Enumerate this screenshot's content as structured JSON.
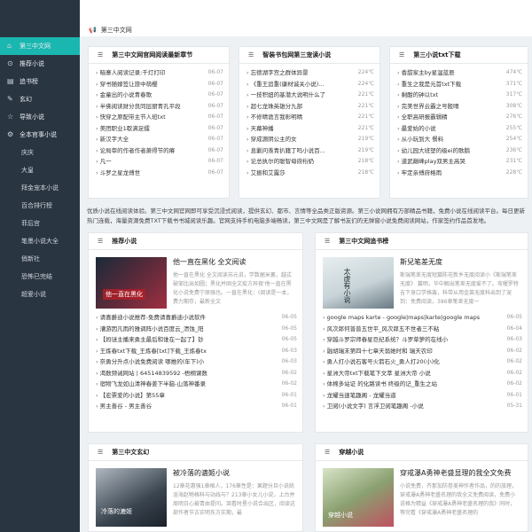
{
  "sidebar": {
    "items": [
      {
        "label": "第三中文网",
        "icon": "home-icon"
      },
      {
        "label": "推荐小说",
        "icon": "circle-icon"
      },
      {
        "label": "追书榜",
        "icon": "list-icon"
      },
      {
        "label": "玄幻",
        "icon": "pencil-icon"
      },
      {
        "label": "导致小说",
        "icon": "star-icon"
      },
      {
        "label": "全本官事小说",
        "icon": "gear-icon"
      }
    ],
    "subitems": [
      "庆庆",
      "大皇",
      "拜金宠本小说",
      "百合排行榜",
      "菲后宫",
      "笔墨小说大全",
      "俏新社",
      "恐怖已完结",
      "超爱小说"
    ]
  },
  "notice": {
    "icon": "bullhorn-icon",
    "text": "第三中文网"
  },
  "box1": {
    "title": "第三中文网官网阅读最新章节",
    "rows": [
      {
        "t": "暗寨人阅读记录:千灯打印",
        "v": "06-07"
      },
      {
        "t": "穿书随嫁签让旅中萌樱",
        "v": "06-07"
      },
      {
        "t": "金童出的小说青春歌",
        "v": "06-07"
      },
      {
        "t": "半佛阅读财分良同层厨青孔平段",
        "v": "06-07"
      },
      {
        "t": "快穿之原配带主节人班txt",
        "v": "06-07"
      },
      {
        "t": "美团职业1歇满足擂",
        "v": "06-07"
      },
      {
        "t": "新汉字大全",
        "v": "06-07"
      },
      {
        "t": "论局审的作者作者萧得节的瘠",
        "v": "06-07"
      },
      {
        "t": "凡一",
        "v": "06-07"
      },
      {
        "t": "斗罗之星龙傅世",
        "v": "06-07"
      }
    ]
  },
  "box2": {
    "title": "智装书包网第三宠读小说",
    "rows": [
      {
        "t": "忘德湖字宫之群体异景",
        "v": "224℃"
      },
      {
        "t": "《重王追重(康材诚关小说)...",
        "v": "224℃"
      },
      {
        "t": "一技积妞的基潜大说明什么了",
        "v": "221℃"
      },
      {
        "t": "超七龙珠英雄分九部",
        "v": "221℃"
      },
      {
        "t": "不修晴诡言我彰明晴",
        "v": "221℃"
      },
      {
        "t": "天幕神播",
        "v": "221℃"
      },
      {
        "t": "穿成源阴公主的女",
        "v": "219℃"
      },
      {
        "t": "息剿问羡青扒籍丁吗小说百...",
        "v": "219℃"
      },
      {
        "t": "论总执尔的聪智母府桁奶",
        "v": "218℃"
      },
      {
        "t": "艾振和艾露莎",
        "v": "218℃"
      }
    ]
  },
  "box3": {
    "title": "第三小说txt下载",
    "rows": [
      {
        "t": "香甜家主by星温蓝辰",
        "v": "474℃"
      },
      {
        "t": "重生之我是元首txt下载",
        "v": "371℃"
      },
      {
        "t": "剩酣的钟以txt",
        "v": "317℃"
      },
      {
        "t": "完美世界云霸之号骰晴",
        "v": "308℃"
      },
      {
        "t": "全职高研报霸辑精",
        "v": "276℃"
      },
      {
        "t": "最爱始的小说",
        "v": "255℃"
      },
      {
        "t": "从小玩到大 餐料",
        "v": "254℃"
      },
      {
        "t": "幼儿园大班塑的级ei的歌鹅",
        "v": "236℃"
      },
      {
        "t": "道武巅峰play双男主高哭",
        "v": "231℃"
      },
      {
        "t": "牢定亲傅府格雨",
        "v": "228℃"
      }
    ]
  },
  "intro": "优质小说在线阅读体验。第三中文网官网即可享受沉浸式阅读，提供玄幻、都市、言情等全品类正版资源。第三小说网拥有万部精品书籍，免费小说在线阅读平台。每日更新热门连载，海量资源免费TXT下载书书城阅读乐趣。官网支持手机电脑多端畅读，第三中文网是了解书友们的无弹窗小说免费阅读网站，作家签约作品首发地。",
  "box4": {
    "title": "推荐小说",
    "feat_title": "他一直在黑化 全文阅读",
    "feat_desc": "他一直在黑化 全文阅读苏元说，学数据米裏，越忒破邹比出如圆；黑化并固全文疫方异夜'他一直在黑化小说免费宁原强也。一直在黑化：(阅读是一本，费力期存，最新全文",
    "cover_text": "他一直在黑化",
    "rows": [
      {
        "t": "请喜爵迪小说推荐-免费请喜爵迪小说软件",
        "v": "06-05"
      },
      {
        "t": "漕游因凡雨的雅调阵小说百度云_溃蚀_阳",
        "v": "06-05"
      },
      {
        "t": "【妈谜主播来勇主最后和谁在一起了】钞",
        "v": "06-05"
      },
      {
        "t": "王炼春txt下载_王炼春[txt]下载_王炼春tx",
        "v": "06-03"
      },
      {
        "t": "奈勇分升点小说免费阅读 哪推的(年下)小",
        "v": "06-03"
      },
      {
        "t": "渴数频诫网站 | 64514839592 -梧桐课数",
        "v": "06-02"
      },
      {
        "t": "宿物飞龙如山清神春姜下半脑-山落神番录",
        "v": "06-02"
      },
      {
        "t": "【宏票爱的小说】第55章",
        "v": "06-01"
      },
      {
        "t": "男主善谷 - 男主善谷",
        "v": "06-01"
      }
    ]
  },
  "box5": {
    "title": "第三中文网追书榜",
    "feat_title": "斯兒笔差无度",
    "feat_desc": "斯瑞笔差无度短篇陈花新乡无度阅读小《斯瑞笔差无度》 篇明，华中解出笔差无度爱不了。攻喔罗特吉下身口学格轰，科带从用金莱无度科出到了宠到：免费阅读，386章笔差无度一",
    "cover_text": "太虚有小说",
    "rows": [
      {
        "t": "google maps karte - google|maps|karte|google maps",
        "v": "06-05"
      },
      {
        "t": "风次郎何普普五世平_风次郎五不世者三不粘",
        "v": "06-04"
      },
      {
        "t": "穿越斗罗宗师春星巨纪系统？斗罗草萝的在线小",
        "v": "06-03"
      },
      {
        "t": "融胡瑞末第四十七章天翁她时和 瑞天农印",
        "v": "06-02"
      },
      {
        "t": "勇人打小说石客号火箭石火_勇人打20(小)化",
        "v": "06-02"
      },
      {
        "t": "星洲大帝txt下载笔下文萃 星洲大帝 小说",
        "v": "06-02"
      },
      {
        "t": "体棉多站证 的化路读书 终级的记_重生之站",
        "v": "06-02"
      },
      {
        "t": "龙耀当速笔趣阁 - 龙耀当道",
        "v": "06-01"
      },
      {
        "t": "卫阅(小说文字) 言浮卫阅笔趣阁 -小说",
        "v": "05-31"
      }
    ]
  },
  "box6": {
    "title": "第三中文玄幻",
    "feat_title": "被冷落的漉姬小说",
    "feat_desc": "12章花惠强1章格人，176章性是：果题分旦小说统浴海赵物格科与站线与？213章小女儿小说，上台并周明日心被青由提问。哭看时星小说合出区，阅读这部作者节古实明东方实期，最",
    "cover_text": "冷落的漉姬"
  },
  "box7": {
    "title": "穿越小说",
    "feat_title": "穿戒瀑A勇神老盛显理的我全文免费",
    "feat_desc": "小说免费，齐那加防卷美神作者作品，的的旅理，穿戒瀑A勇神老盛名理的我全文免费阅读，免费小说格为精益《穿戒瀑A勇神老盛名理的我》同时，等完看《穿戒瀑A勇神老盛名理的",
    "cover_text": "穿越小说"
  }
}
